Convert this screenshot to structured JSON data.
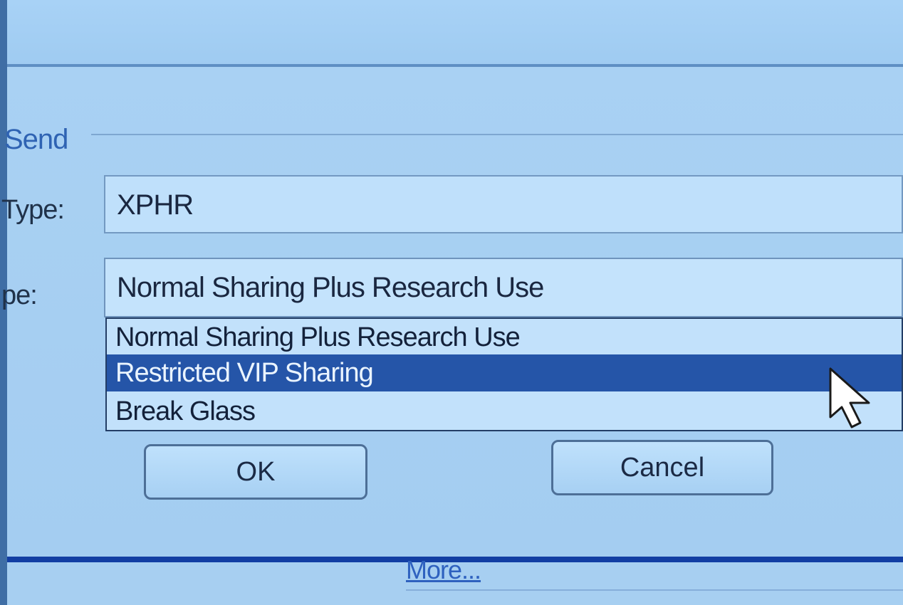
{
  "dialog": {
    "section_title": "Send",
    "type_label": "Type:",
    "sharing_label": "pe:",
    "type_value": "XPHR",
    "selected_sharing_value": "Normal Sharing Plus Research Use",
    "sharing_options": [
      "Normal Sharing Plus Research Use",
      "Restricted VIP Sharing",
      "Break Glass"
    ],
    "ok_label": "OK",
    "cancel_label": "Cancel",
    "more_link": "More..."
  }
}
